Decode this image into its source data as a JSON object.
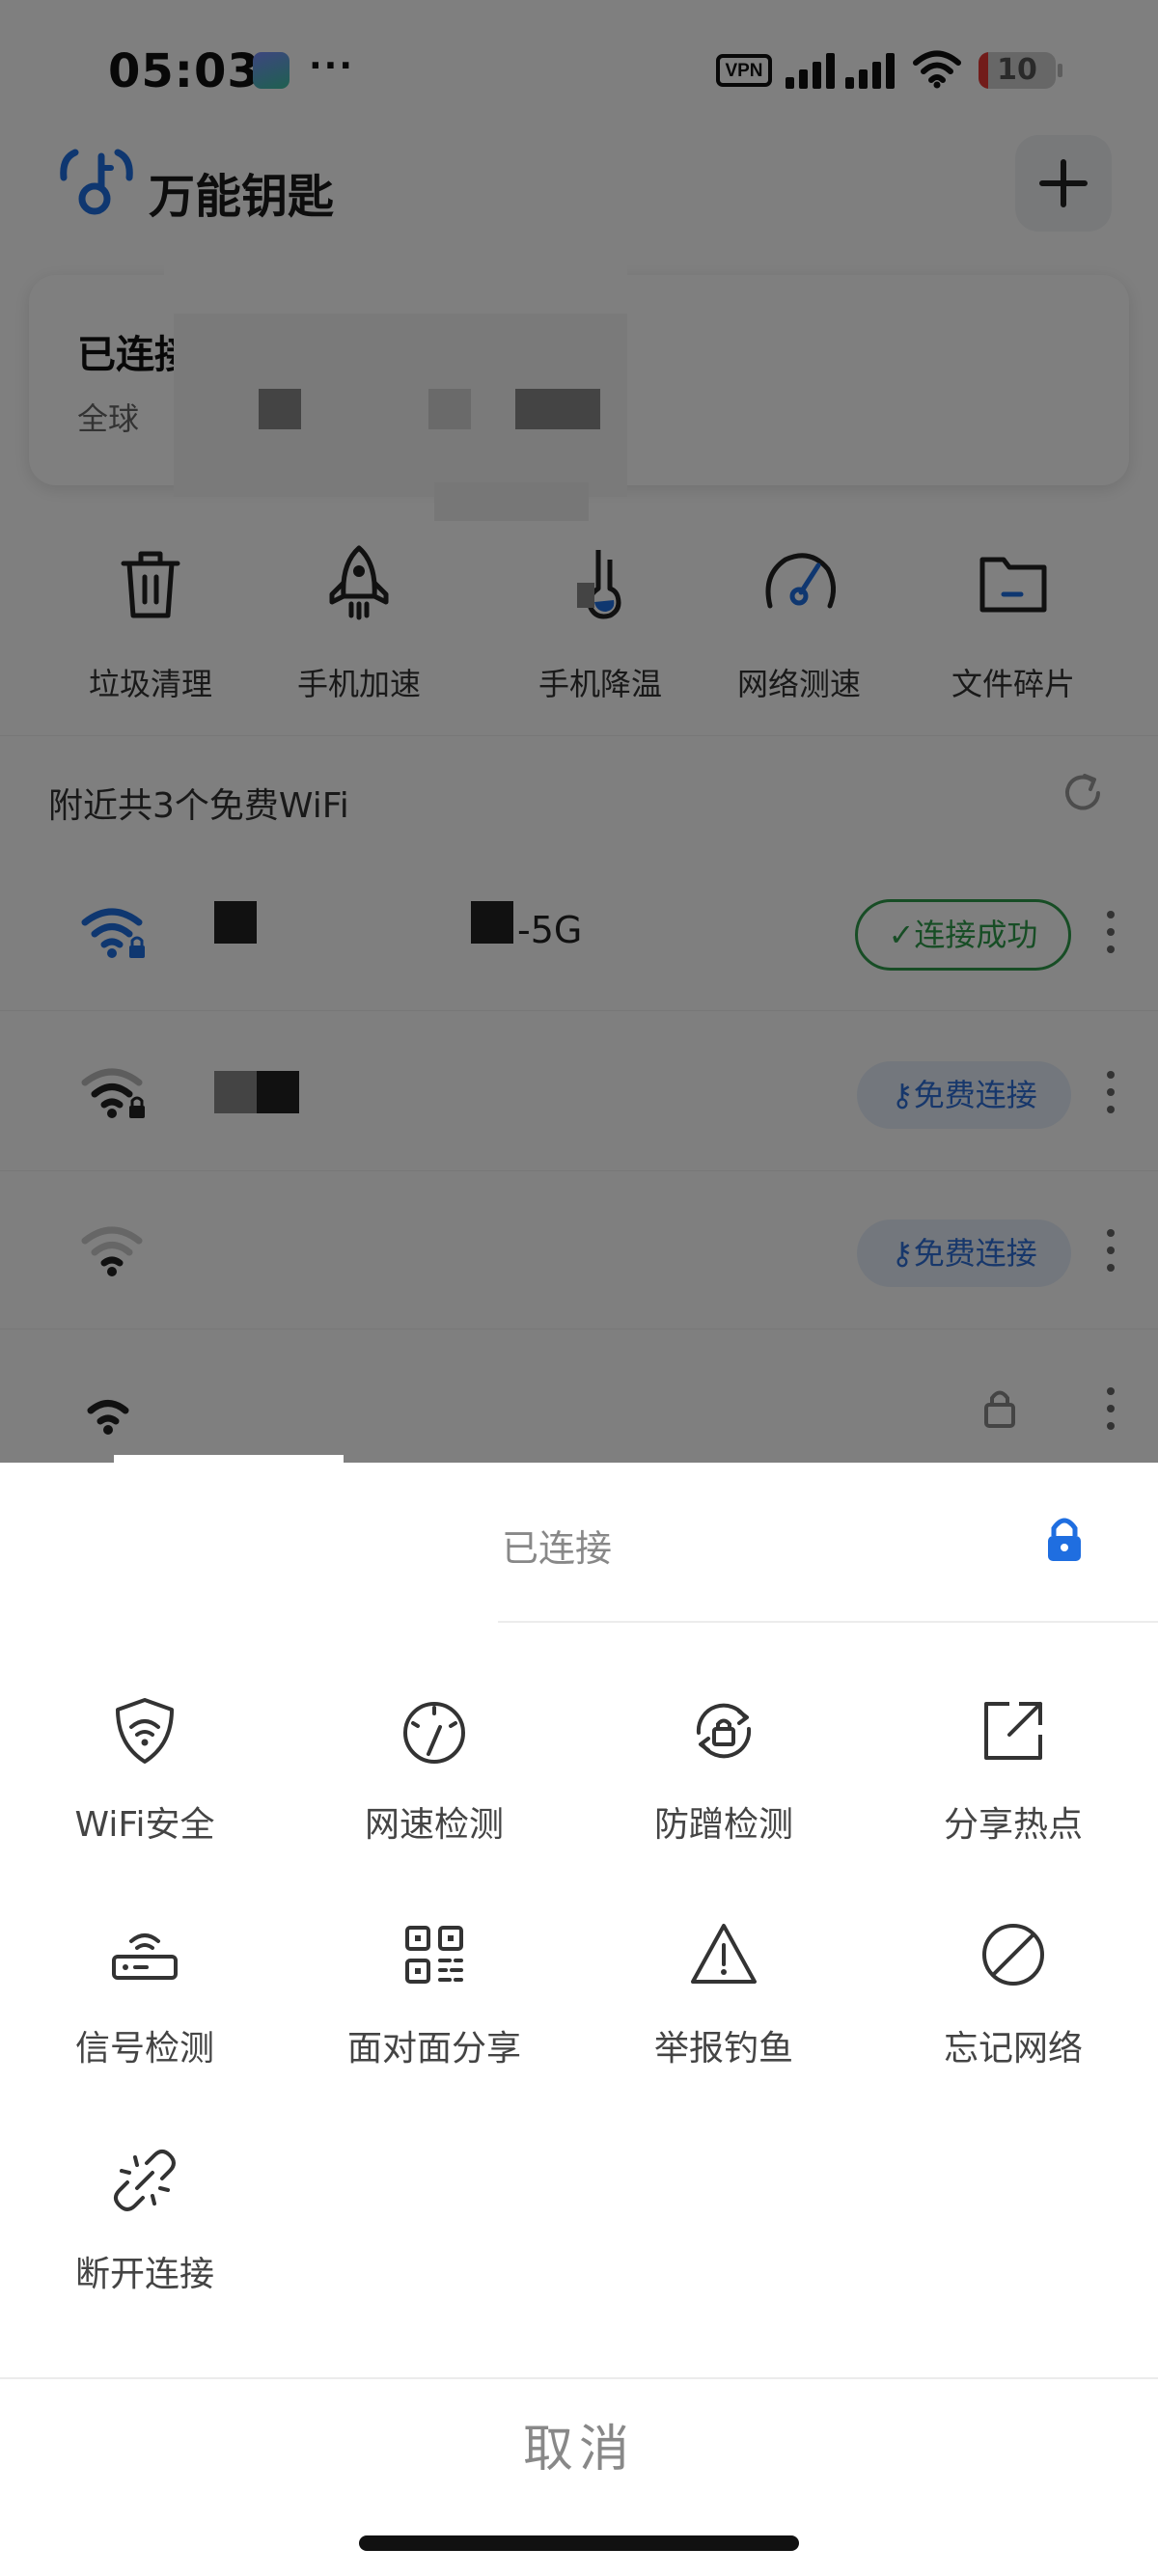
{
  "status_bar": {
    "time": "05:03",
    "more": "···",
    "vpn": "VPN",
    "battery": "10"
  },
  "header": {
    "app_name": "万能钥匙",
    "add_icon": "plus-icon"
  },
  "connection_card": {
    "title": "已连接",
    "subtitle": "全球"
  },
  "tools": [
    {
      "label": "垃圾清理",
      "icon": "trash-icon"
    },
    {
      "label": "手机加速",
      "icon": "rocket-icon"
    },
    {
      "label": "手机降温",
      "icon": "thermometer-icon"
    },
    {
      "label": "网络测速",
      "icon": "speedometer-icon"
    },
    {
      "label": "文件碎片",
      "icon": "folder-icon"
    }
  ],
  "nearby": {
    "title": "附近共3个免费WiFi",
    "refresh_icon": "refresh-icon"
  },
  "wifi_list": [
    {
      "name_suffix": "-5G",
      "action": "连接成功",
      "state": "connected"
    },
    {
      "name_suffix": "",
      "action": "免费连接",
      "state": "free"
    },
    {
      "name_suffix": "",
      "action": "免费连接",
      "state": "free"
    },
    {
      "name_suffix": "",
      "action": "",
      "state": "locked"
    }
  ],
  "sheet": {
    "status": "已连接",
    "lock_icon": "lock-icon",
    "actions": [
      {
        "label": "WiFi安全",
        "icon": "shield-wifi-icon"
      },
      {
        "label": "网速检测",
        "icon": "gauge-icon"
      },
      {
        "label": "防蹭检测",
        "icon": "anti-leech-icon"
      },
      {
        "label": "分享热点",
        "icon": "share-icon"
      },
      {
        "label": "信号检测",
        "icon": "router-icon"
      },
      {
        "label": "面对面分享",
        "icon": "qrcode-icon"
      },
      {
        "label": "举报钓鱼",
        "icon": "warning-icon"
      },
      {
        "label": "忘记网络",
        "icon": "forbidden-icon"
      },
      {
        "label": "断开连接",
        "icon": "unlink-icon"
      }
    ],
    "cancel": "取消"
  },
  "colors": {
    "brand_blue": "#1f6ee0",
    "success_green": "#2e9a4b",
    "free_blue": "#2e6fd6"
  }
}
